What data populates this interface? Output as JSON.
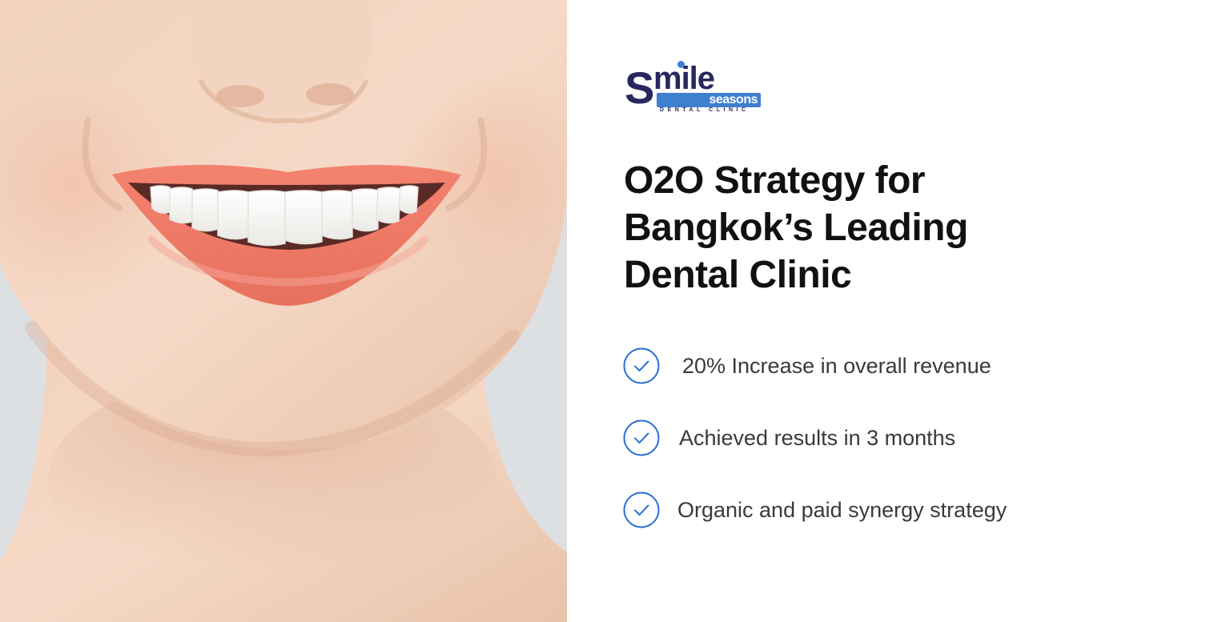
{
  "logo": {
    "brand_letter": "S",
    "brand_rest": "mile",
    "brand_sub": "seasons",
    "tagline": "DENTAL CLINIC",
    "colors": {
      "navy": "#28275f",
      "blue": "#3f7fd0"
    }
  },
  "headline": {
    "line1": "O2O Strategy for",
    "line2": "Bangkok’s Leading",
    "line3": "Dental Clinic"
  },
  "benefits": [
    {
      "icon": "check-circle-icon",
      "text": "20% Increase in overall revenue"
    },
    {
      "icon": "check-circle-icon",
      "text": "Achieved results in 3 months"
    },
    {
      "icon": "check-circle-icon",
      "text": "Organic and paid synergy strategy"
    }
  ],
  "colors": {
    "accent": "#2f6fd6",
    "headline": "#111111",
    "body_text": "#3a3a3a",
    "background": "#ffffff",
    "photo_backdrop": "#dde0e3"
  }
}
